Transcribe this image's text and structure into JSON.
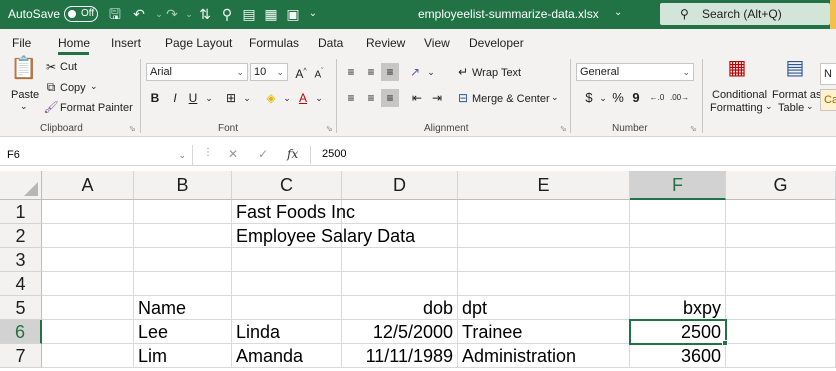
{
  "titlebar": {
    "autosave_label": "AutoSave",
    "autosave_state": "Off",
    "filename": "employeelist-summarize-data.xlsx",
    "search_placeholder": "Search (Alt+Q)"
  },
  "tabs": [
    "File",
    "Home",
    "Insert",
    "Page Layout",
    "Formulas",
    "Data",
    "Review",
    "View",
    "Developer"
  ],
  "active_tab": "Home",
  "ribbon": {
    "clipboard": {
      "paste": "Paste",
      "cut": "Cut",
      "copy": "Copy",
      "format_painter": "Format Painter",
      "group": "Clipboard"
    },
    "font": {
      "name": "Arial",
      "size": "10",
      "bold": "B",
      "italic": "I",
      "underline": "U",
      "group": "Font"
    },
    "alignment": {
      "wrap_text": "Wrap Text",
      "merge_center": "Merge & Center",
      "group": "Alignment"
    },
    "number": {
      "format": "General",
      "currency": "$",
      "percent": "%",
      "comma": "9",
      "group": "Number"
    },
    "styles": {
      "conditional_1": "Conditional",
      "conditional_2": "Formatting",
      "format_as_1": "Format as",
      "format_as_2": "Table",
      "style_n": "N",
      "style_c": "Ca"
    }
  },
  "formula_bar": {
    "name_box": "F6",
    "fx": "fx",
    "value": "2500"
  },
  "grid": {
    "columns": [
      "A",
      "B",
      "C",
      "D",
      "E",
      "F",
      "G"
    ],
    "rows": [
      "1",
      "2",
      "3",
      "4",
      "5",
      "6",
      "7"
    ],
    "selected_column": "F",
    "selected_row": "6",
    "cells": {
      "C1": "Fast Foods Inc",
      "C2": "Employee Salary Data",
      "B5": "Name",
      "D5": "dob",
      "E5": "dpt",
      "F5": "bxpy",
      "B6": "Lee",
      "C6": "Linda",
      "D6": "12/5/2000",
      "E6": "Trainee",
      "F6": "2500",
      "B7": "Lim",
      "C7": "Amanda",
      "D7": "11/11/1989",
      "E7": "Administration",
      "F7": "3600"
    }
  },
  "colors": {
    "brand": "#217346",
    "accent": "#f3c04c"
  }
}
